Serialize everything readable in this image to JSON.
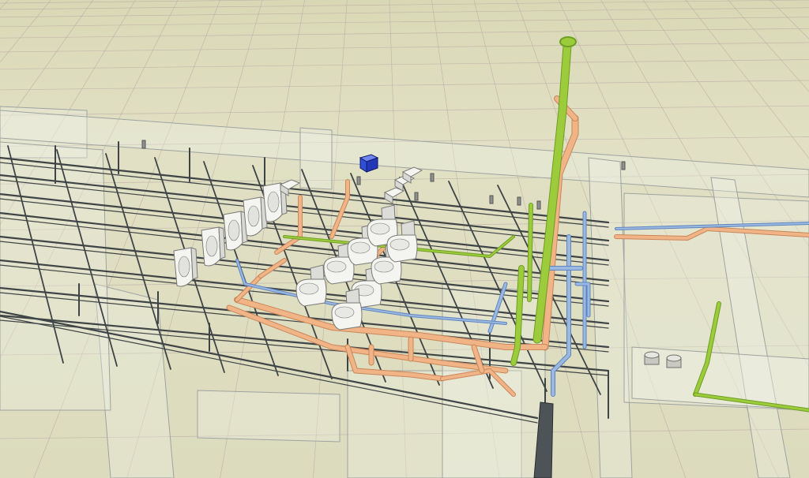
{
  "scene": {
    "kind": "3d-plumbing-model-viewport",
    "colors": {
      "background": "#e3e2c6",
      "grid_line": "#b9a8a4",
      "framing": "#3f4446",
      "wall_glass": "#eef0e4",
      "wall_edge": "#9ea3a0",
      "vent_pipe": "#9ccc3c",
      "vent_pipe_dark": "#6e9e22",
      "waste_pipe": "#f0b487",
      "waste_pipe_dark": "#c9875a",
      "water_pipe": "#9bb8e0",
      "water_pipe_dark": "#5f85bf",
      "fixture": "#f4f4f1",
      "fixture_edge": "#7a7a76",
      "selected_box": "#2f4fd8"
    },
    "fixtures": {
      "urinal_count": 6,
      "toilet_count": 8,
      "sink_count": 4,
      "selected_box_count": 1
    }
  }
}
